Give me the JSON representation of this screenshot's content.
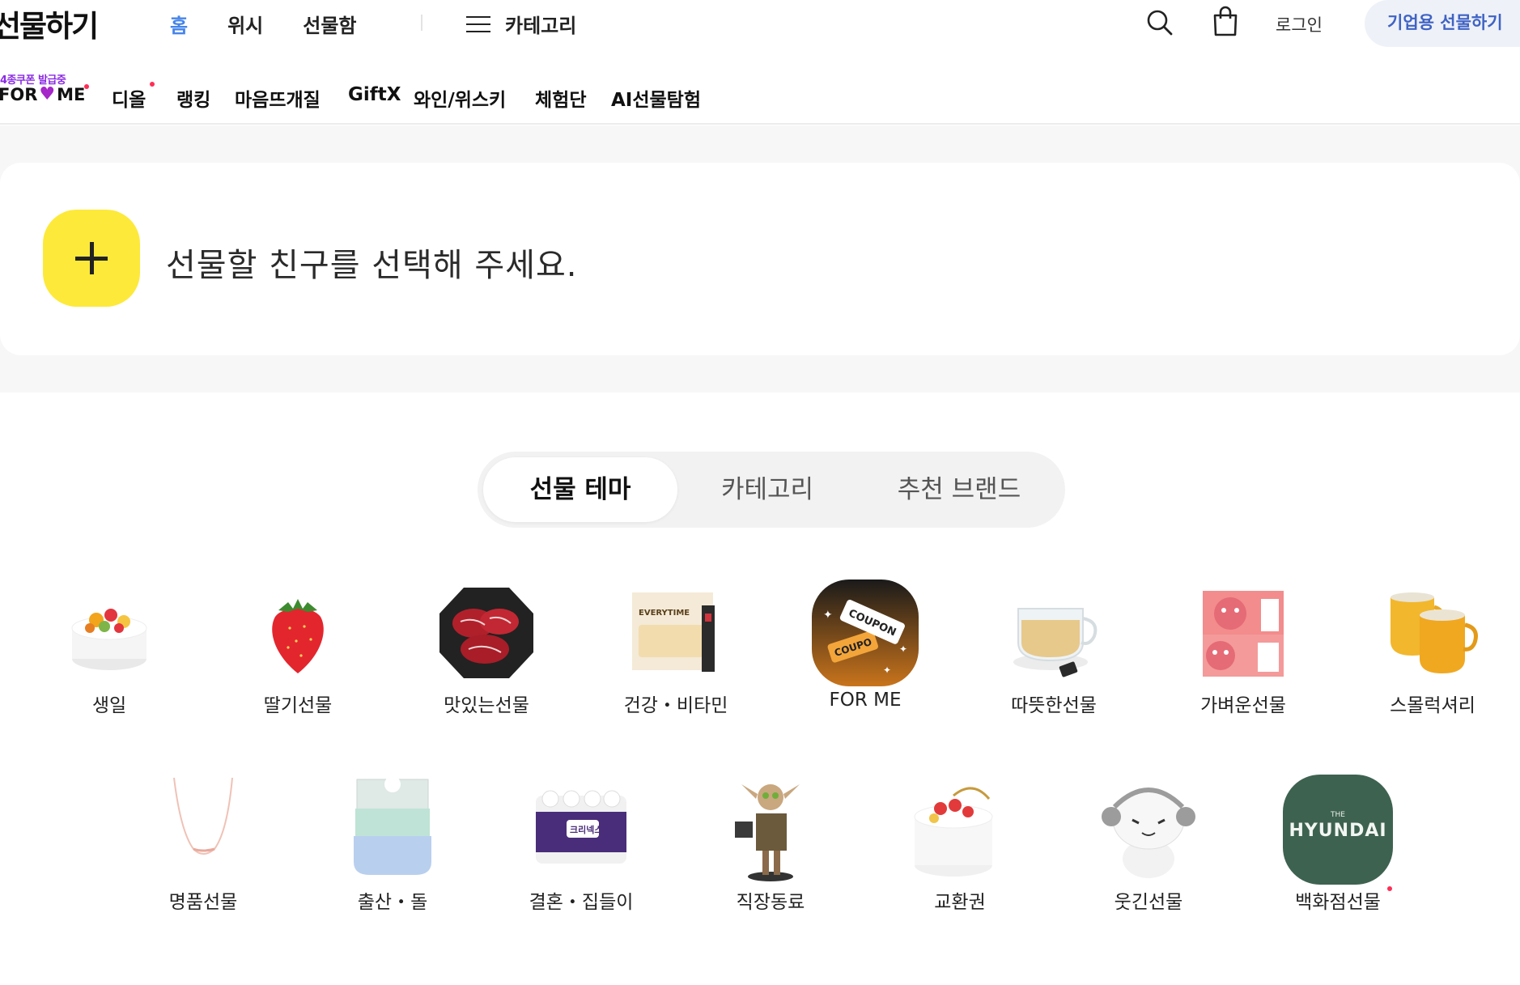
{
  "header": {
    "logo": "선물하기",
    "nav": [
      {
        "label": "홈",
        "active": true
      },
      {
        "label": "위시",
        "active": false
      },
      {
        "label": "선물함",
        "active": false
      }
    ],
    "category_button": "카테고리",
    "login": "로그인",
    "business_button": "기업용 선물하기",
    "search_icon": "search-icon",
    "cart_icon": "shopping-bag-icon"
  },
  "subnav": {
    "forme_coupon": "4종쿠폰 발급중",
    "forme_brand_left": "FOR",
    "forme_brand_heart": "♥",
    "forme_brand_right": "ME",
    "items": [
      "디올",
      "랭킹",
      "마음뜨개질",
      "GiftX",
      "와인/위스키",
      "체험단",
      "AI선물탐험"
    ]
  },
  "friend_select": {
    "plus_icon": "plus-icon",
    "prompt": "선물할 친구를 선택해 주세요."
  },
  "tabs": [
    {
      "label": "선물 테마",
      "active": true
    },
    {
      "label": "카테고리",
      "active": false
    },
    {
      "label": "추천 브랜드",
      "active": false
    }
  ],
  "themes": [
    {
      "label": "생일",
      "icon": "birthday-cake-icon"
    },
    {
      "label": "딸기선물",
      "icon": "strawberry-icon"
    },
    {
      "label": "맛있는선물",
      "icon": "beef-icon"
    },
    {
      "label": "건강・비타민",
      "icon": "health-supplement-icon"
    },
    {
      "label": "FOR ME",
      "icon": "coupon-icon"
    },
    {
      "label": "따뜻한선물",
      "icon": "tea-cup-icon"
    },
    {
      "label": "가벼운선물",
      "icon": "gift-box-icon"
    },
    {
      "label": "스몰럭셔리",
      "icon": "mugs-icon"
    },
    {
      "label": "명품선물",
      "icon": "necklace-icon"
    },
    {
      "label": "출산・돌",
      "icon": "baby-bib-icon"
    },
    {
      "label": "결혼・집들이",
      "icon": "tissue-pack-icon"
    },
    {
      "label": "직장동료",
      "icon": "figure-icon"
    },
    {
      "label": "교환권",
      "icon": "cake-voucher-icon"
    },
    {
      "label": "웃긴선물",
      "icon": "cat-plush-icon"
    },
    {
      "label": "백화점선물",
      "icon": "hyundai-logo-icon",
      "new": true
    }
  ],
  "hyundai_logo": {
    "small": "THE",
    "main": "HYUNDAI"
  },
  "coupon_art": {
    "text": "COUPON",
    "text_back": "COUPO"
  },
  "supplement_art": {
    "text": "EVERYTIME"
  },
  "tissue_art": {
    "text": "크리넥스"
  },
  "colors": {
    "accent_blue": "#4684e9",
    "plus_yellow": "#fde93a",
    "business_text": "#3f63c4",
    "new_dot": "#ff2d55",
    "forme_heart": "#a526c9"
  }
}
